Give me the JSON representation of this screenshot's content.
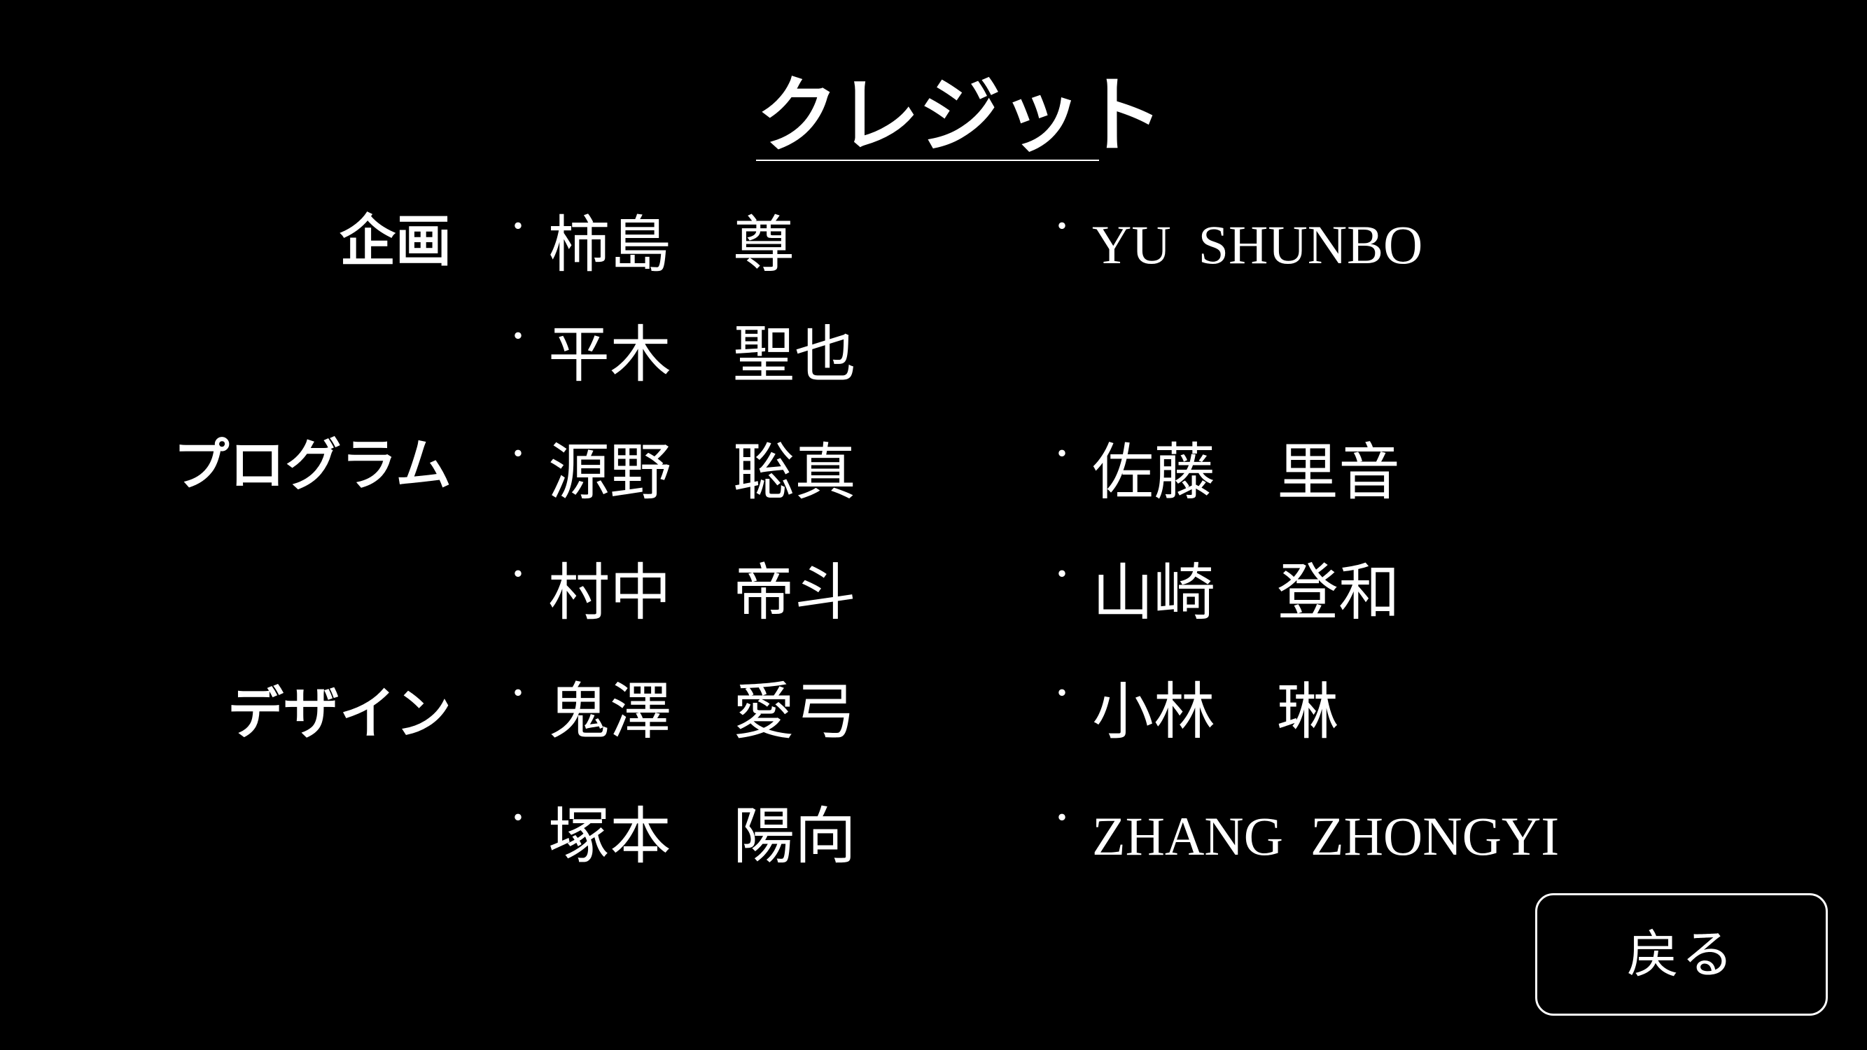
{
  "title": "クレジット",
  "sections": [
    {
      "role": "企画",
      "names": [
        "柿島　尊",
        "YU  SHUNBO",
        "平木　聖也"
      ]
    },
    {
      "role": "プログラム",
      "names": [
        "源野　聡真",
        "佐藤　里音",
        "村中　帝斗",
        "山崎　登和"
      ]
    },
    {
      "role": "デザイン",
      "names": [
        "鬼澤　愛弓",
        "小林　琳",
        "塚本　陽向",
        "ZHANG  ZHONGYI"
      ]
    }
  ],
  "bullet": "・",
  "back_button": {
    "label": "戻る"
  },
  "colors": {
    "background": "#000000",
    "text": "#ffffff"
  }
}
